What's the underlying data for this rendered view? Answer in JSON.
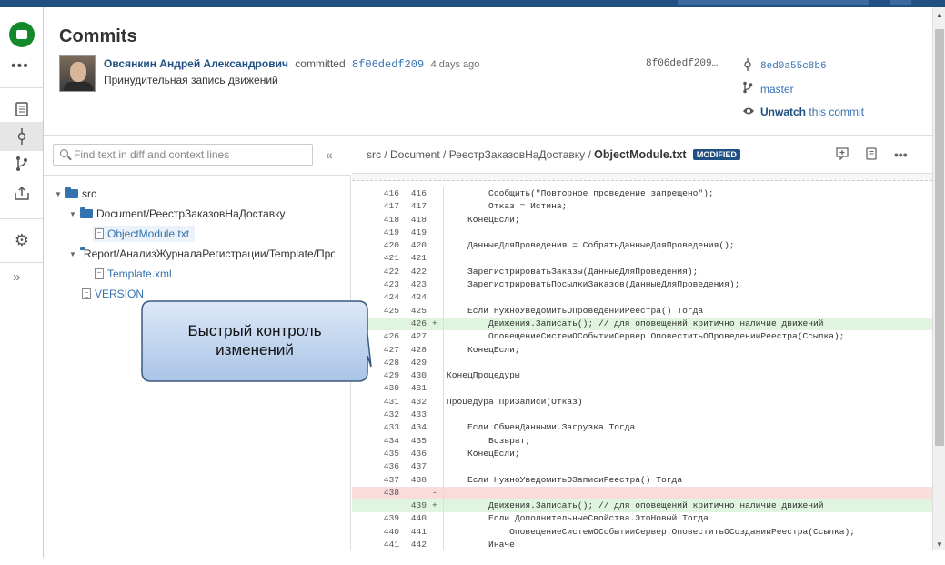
{
  "header": {
    "title": "Commits",
    "author": "Овсянкин Андрей Александрович",
    "action": "committed",
    "hash": "8f06dedf209",
    "time_ago": "4 days ago",
    "message": "Принудительная запись движений",
    "hash_right": "8f06dedf209…",
    "parent_hash": "8ed0a55c8b6",
    "branch": "master",
    "watch_label": "Unwatch",
    "watch_suffix": "this commit"
  },
  "search": {
    "placeholder": "Find text in diff and context lines",
    "value": ""
  },
  "tree": {
    "root": "src",
    "folder1": "Document/РеестрЗаказовНаДоставку",
    "file1": "ObjectModule.txt",
    "folder2": "Report/АнализЖурналаРегистрации/Template/Про",
    "file2": "Template.xml",
    "file3": "VERSION"
  },
  "diff_header": {
    "path": "src / Document / РеестрЗаказовНаДоставку /",
    "filename": "ObjectModule.txt",
    "badge": "MODIFIED"
  },
  "diff_lines": [
    {
      "o": "416",
      "n": "416",
      "m": "",
      "t": "        Сообщить(\"Повторное проведение запрещено\");",
      "k": "ctx"
    },
    {
      "o": "417",
      "n": "417",
      "m": "",
      "t": "        Отказ = Истина;",
      "k": "ctx"
    },
    {
      "o": "418",
      "n": "418",
      "m": "",
      "t": "    КонецЕсли;",
      "k": "ctx"
    },
    {
      "o": "419",
      "n": "419",
      "m": "",
      "t": "",
      "k": "ctx"
    },
    {
      "o": "420",
      "n": "420",
      "m": "",
      "t": "    ДанныеДляПроведения = СобратьДанныеДляПроведения();",
      "k": "ctx"
    },
    {
      "o": "421",
      "n": "421",
      "m": "",
      "t": "",
      "k": "ctx"
    },
    {
      "o": "422",
      "n": "422",
      "m": "",
      "t": "    ЗарегистрироватьЗаказы(ДанныеДляПроведения);",
      "k": "ctx"
    },
    {
      "o": "423",
      "n": "423",
      "m": "",
      "t": "    ЗарегистрироватьПосылкиЗаказов(ДанныеДляПроведения);",
      "k": "ctx"
    },
    {
      "o": "424",
      "n": "424",
      "m": "",
      "t": "",
      "k": "ctx"
    },
    {
      "o": "425",
      "n": "425",
      "m": "",
      "t": "    Если НужноУведомитьОПроведенииРеестра() Тогда",
      "k": "ctx"
    },
    {
      "o": "",
      "n": "426",
      "m": "+",
      "t": "        Движения.Записать(); // для оповещений критично наличие движений",
      "k": "add"
    },
    {
      "o": "426",
      "n": "427",
      "m": "",
      "t": "        ОповещениеСистемОСобытииСервер.ОповеститьОПроведенииРеестра(Ссылка);",
      "k": "ctx"
    },
    {
      "o": "427",
      "n": "428",
      "m": "",
      "t": "    КонецЕсли;",
      "k": "ctx"
    },
    {
      "o": "428",
      "n": "429",
      "m": "",
      "t": "",
      "k": "ctx"
    },
    {
      "o": "429",
      "n": "430",
      "m": "",
      "t": "КонецПроцедуры",
      "k": "ctx"
    },
    {
      "o": "430",
      "n": "431",
      "m": "",
      "t": "",
      "k": "ctx"
    },
    {
      "o": "431",
      "n": "432",
      "m": "",
      "t": "Процедура ПриЗаписи(Отказ)",
      "k": "ctx"
    },
    {
      "o": "432",
      "n": "433",
      "m": "",
      "t": "",
      "k": "ctx"
    },
    {
      "o": "433",
      "n": "434",
      "m": "",
      "t": "    Если ОбменДанными.Загрузка Тогда",
      "k": "ctx"
    },
    {
      "o": "434",
      "n": "435",
      "m": "",
      "t": "        Возврат;",
      "k": "ctx"
    },
    {
      "o": "435",
      "n": "436",
      "m": "",
      "t": "    КонецЕсли;",
      "k": "ctx"
    },
    {
      "o": "436",
      "n": "437",
      "m": "",
      "t": "",
      "k": "ctx"
    },
    {
      "o": "437",
      "n": "438",
      "m": "",
      "t": "    Если НужноУведомитьОЗаписиРеестра() Тогда",
      "k": "ctx"
    },
    {
      "o": "438",
      "n": "",
      "m": "-",
      "t": "",
      "k": "del"
    },
    {
      "o": "",
      "n": "439",
      "m": "+",
      "t": "        Движения.Записать(); // для оповещений критично наличие движений",
      "k": "add"
    },
    {
      "o": "439",
      "n": "440",
      "m": "",
      "t": "        Если ДополнительныеСвойства.ЭтоНовый Тогда",
      "k": "ctx"
    },
    {
      "o": "440",
      "n": "441",
      "m": "",
      "t": "            ОповещениеСистемОСобытииСервер.ОповеститьОСозданииРеестра(Ссылка);",
      "k": "ctx"
    },
    {
      "o": "441",
      "n": "442",
      "m": "",
      "t": "        Иначе",
      "k": "ctx"
    }
  ],
  "callout": {
    "line1": "Быстрый контроль",
    "line2": "изменений"
  },
  "colors": {
    "brand": "#205081",
    "link": "#3572b0",
    "added": "#dff5df",
    "removed": "#fadcdc",
    "logo": "#14892c"
  }
}
